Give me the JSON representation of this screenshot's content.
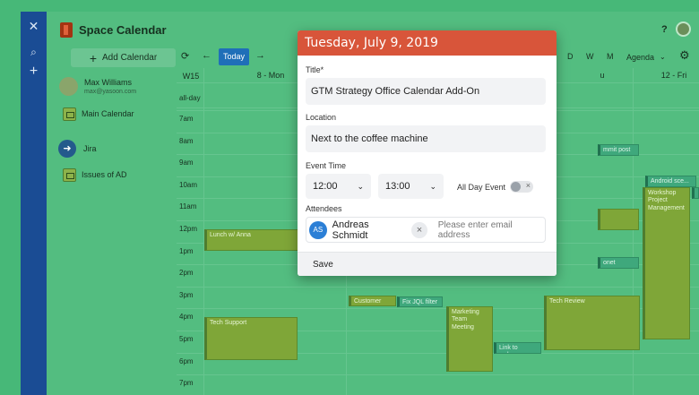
{
  "rail": {
    "icons": [
      "confluence-icon",
      "search-icon",
      "plus-icon"
    ]
  },
  "app": {
    "title": "Space Calendar"
  },
  "topbar": {
    "help": "?"
  },
  "sidebar": {
    "add_calendar": "Add Calendar",
    "user": {
      "name": "Max Williams",
      "email": "max@yasoon.com"
    },
    "calendars": [
      {
        "label": "Main Calendar"
      },
      {
        "label": "Jira"
      },
      {
        "label": "Issues of AD"
      }
    ]
  },
  "toolbar": {
    "refresh": "⟳",
    "prev": "←",
    "today": "Today",
    "next": "→",
    "views": [
      "D",
      "W",
      "M"
    ],
    "agenda": "Agenda",
    "settings": "⚙"
  },
  "grid": {
    "week": "W15",
    "day_left": "8 - Mon",
    "day_mid": "u",
    "day_right": "12 - Fri",
    "allday": "all-day",
    "times": [
      "7am",
      "8am",
      "9am",
      "10am",
      "11am",
      "12pm",
      "1pm",
      "2pm",
      "3pm",
      "4pm",
      "5pm",
      "6pm",
      "7pm"
    ]
  },
  "events": [
    {
      "label": "Lunch w/ Anna",
      "color": "#7fa638"
    },
    {
      "label": "Tech Support",
      "color": "#7fa638"
    },
    {
      "label": "Customer Call",
      "color": "#7fa638"
    },
    {
      "label": "Fix JQL filter",
      "color": "#3fa87c"
    },
    {
      "label": "Marketing Team Meeting",
      "color": "#7fa638"
    },
    {
      "label": "Link to webs...",
      "color": "#3fa87c"
    },
    {
      "label": "Tech Review",
      "color": "#7fa638"
    },
    {
      "label": "Workshop Project Management",
      "color": "#7fa638"
    },
    {
      "label": "Android sce...",
      "color": "#3fa87c"
    },
    {
      "label": "mmit post ...",
      "color": "#3fa87c"
    },
    {
      "label": "onet acce...",
      "color": "#3fa87c"
    },
    {
      "label": "",
      "color": "#7fa638"
    }
  ],
  "modal": {
    "header": "Tuesday, July 9, 2019",
    "header_color": "#d8553a",
    "title_label": "Title",
    "required_mark": "*",
    "title_value": "GTM Strategy Office Calendar Add-On",
    "location_label": "Location",
    "location_value": "Next to the coffee machine",
    "time_label": "Event Time",
    "start_time": "12:00",
    "end_time": "13:00",
    "all_day_label": "All Day Event",
    "attendees_label": "Attendees",
    "attendee": {
      "initials": "AS",
      "name": "Andreas Schmidt"
    },
    "email_placeholder": "Please enter email address",
    "save": "Save"
  }
}
